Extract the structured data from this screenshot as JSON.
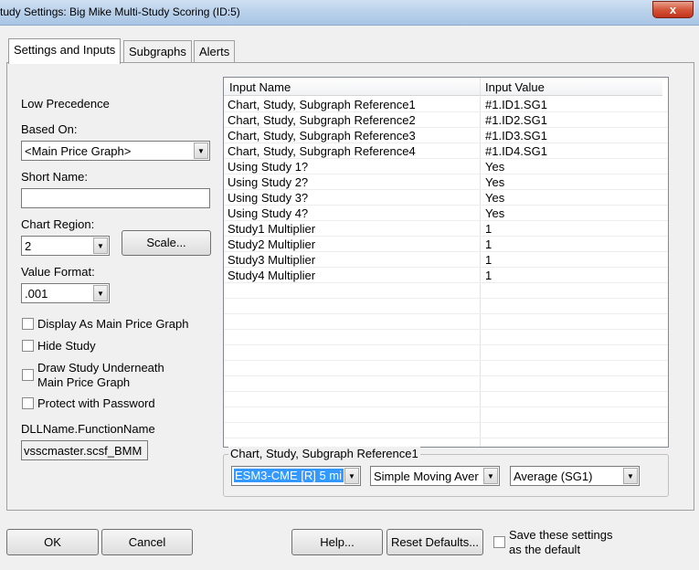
{
  "window": {
    "title": "tudy Settings: Big Mike Multi-Study Scoring (ID:5)",
    "close_glyph": "x"
  },
  "tabs": [
    {
      "label": "Settings and Inputs",
      "active": true
    },
    {
      "label": "Subgraphs",
      "active": false
    },
    {
      "label": "Alerts",
      "active": false
    }
  ],
  "left": {
    "precedence": "Low Precedence",
    "based_on_label": "Based On:",
    "based_on_value": "<Main Price Graph>",
    "short_name_label": "Short Name:",
    "short_name_value": "",
    "chart_region_label": "Chart Region:",
    "chart_region_value": "2",
    "scale_button": "Scale...",
    "value_format_label": "Value Format:",
    "value_format_value": ".001",
    "checkboxes": [
      {
        "label": "Display As Main Price Graph",
        "checked": false
      },
      {
        "label": "Hide Study",
        "checked": false
      },
      {
        "label": "Draw Study Underneath",
        "label2": "Main Price Graph",
        "checked": false
      },
      {
        "label": "Protect with Password",
        "checked": false
      }
    ],
    "dll_label": "DLLName.FunctionName",
    "dll_value": "vsscmaster.scsf_BMM"
  },
  "grid": {
    "columns": [
      "Input Name",
      "Input Value"
    ],
    "rows": [
      [
        "Chart, Study, Subgraph Reference1",
        "#1.ID1.SG1"
      ],
      [
        "Chart, Study, Subgraph Reference2",
        "#1.ID2.SG1"
      ],
      [
        "Chart, Study, Subgraph Reference3",
        "#1.ID3.SG1"
      ],
      [
        "Chart, Study, Subgraph Reference4",
        "#1.ID4.SG1"
      ],
      [
        "Using Study 1?",
        "Yes"
      ],
      [
        "Using Study 2?",
        "Yes"
      ],
      [
        "Using Study 3?",
        "Yes"
      ],
      [
        "Using Study 4?",
        "Yes"
      ],
      [
        "Study1 Multiplier",
        "1"
      ],
      [
        "Study2 Multiplier",
        "1"
      ],
      [
        "Study3 Multiplier",
        "1"
      ],
      [
        "Study4 Multiplier",
        "1"
      ]
    ]
  },
  "editor": {
    "legend": "Chart, Study, Subgraph Reference1",
    "chart_value": "ESM3-CME [R]  5 mi",
    "study_value": "Simple Moving Aver",
    "subgraph_value": "Average (SG1)"
  },
  "buttons": {
    "ok": "OK",
    "cancel": "Cancel",
    "help": "Help...",
    "reset": "Reset Defaults...",
    "save_default_line1": "Save these settings",
    "save_default_line2": "as the default"
  },
  "colors": {
    "selection": "#3399ff",
    "titlebar": "#b9d1ea",
    "close_button": "#c7402a"
  },
  "icons": {
    "dropdown_arrow": "▼"
  }
}
